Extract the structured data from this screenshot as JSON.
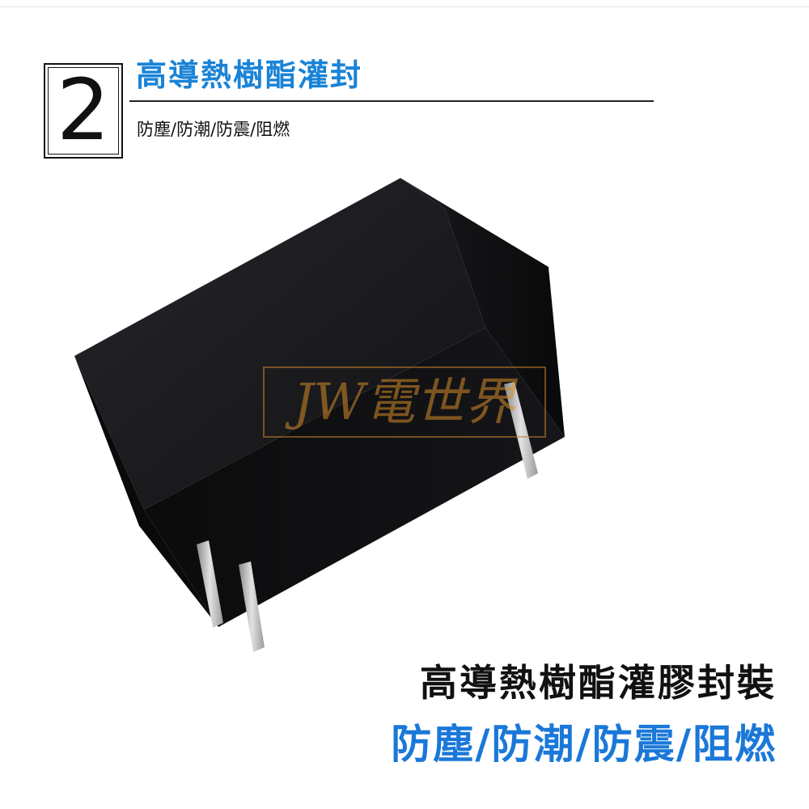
{
  "section": {
    "number": "2",
    "title": "高導熱樹酯灌封",
    "subtitle": "防塵/防潮/防震/阻燃"
  },
  "watermark": {
    "text": "JW電世界",
    "color": "#d68c28"
  },
  "caption": {
    "main": "高導熱樹酯灌膠封裝",
    "sub": "防塵/防潮/防震/阻燃"
  },
  "colors": {
    "accent": "#1a83d6",
    "text": "#111111",
    "product": "#0d0d0f",
    "pin": "#c9c9c9"
  },
  "product": {
    "type": "black rectangular film capacitor with two metal pins"
  }
}
